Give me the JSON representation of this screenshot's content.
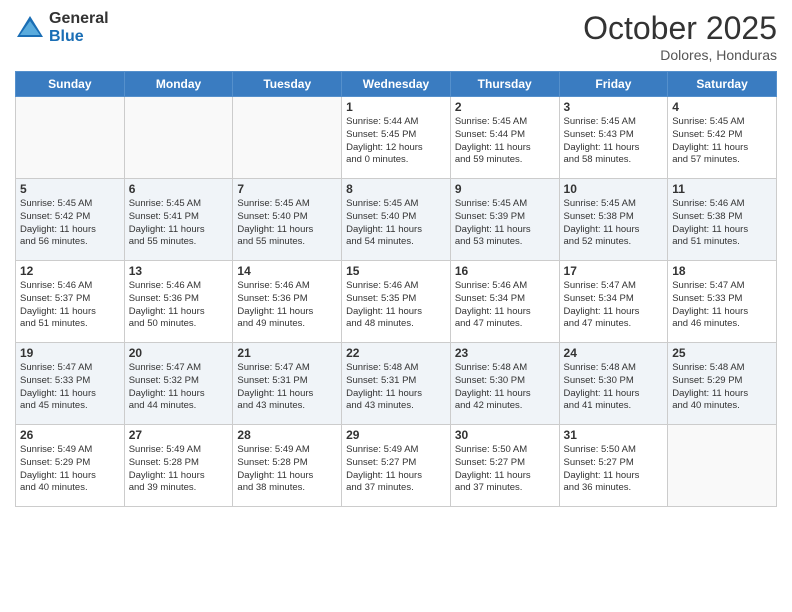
{
  "header": {
    "logo_general": "General",
    "logo_blue": "Blue",
    "month": "October 2025",
    "location": "Dolores, Honduras"
  },
  "days_of_week": [
    "Sunday",
    "Monday",
    "Tuesday",
    "Wednesday",
    "Thursday",
    "Friday",
    "Saturday"
  ],
  "weeks": [
    [
      {
        "day": "",
        "info": ""
      },
      {
        "day": "",
        "info": ""
      },
      {
        "day": "",
        "info": ""
      },
      {
        "day": "1",
        "info": "Sunrise: 5:44 AM\nSunset: 5:45 PM\nDaylight: 12 hours\nand 0 minutes."
      },
      {
        "day": "2",
        "info": "Sunrise: 5:45 AM\nSunset: 5:44 PM\nDaylight: 11 hours\nand 59 minutes."
      },
      {
        "day": "3",
        "info": "Sunrise: 5:45 AM\nSunset: 5:43 PM\nDaylight: 11 hours\nand 58 minutes."
      },
      {
        "day": "4",
        "info": "Sunrise: 5:45 AM\nSunset: 5:42 PM\nDaylight: 11 hours\nand 57 minutes."
      }
    ],
    [
      {
        "day": "5",
        "info": "Sunrise: 5:45 AM\nSunset: 5:42 PM\nDaylight: 11 hours\nand 56 minutes."
      },
      {
        "day": "6",
        "info": "Sunrise: 5:45 AM\nSunset: 5:41 PM\nDaylight: 11 hours\nand 55 minutes."
      },
      {
        "day": "7",
        "info": "Sunrise: 5:45 AM\nSunset: 5:40 PM\nDaylight: 11 hours\nand 55 minutes."
      },
      {
        "day": "8",
        "info": "Sunrise: 5:45 AM\nSunset: 5:40 PM\nDaylight: 11 hours\nand 54 minutes."
      },
      {
        "day": "9",
        "info": "Sunrise: 5:45 AM\nSunset: 5:39 PM\nDaylight: 11 hours\nand 53 minutes."
      },
      {
        "day": "10",
        "info": "Sunrise: 5:45 AM\nSunset: 5:38 PM\nDaylight: 11 hours\nand 52 minutes."
      },
      {
        "day": "11",
        "info": "Sunrise: 5:46 AM\nSunset: 5:38 PM\nDaylight: 11 hours\nand 51 minutes."
      }
    ],
    [
      {
        "day": "12",
        "info": "Sunrise: 5:46 AM\nSunset: 5:37 PM\nDaylight: 11 hours\nand 51 minutes."
      },
      {
        "day": "13",
        "info": "Sunrise: 5:46 AM\nSunset: 5:36 PM\nDaylight: 11 hours\nand 50 minutes."
      },
      {
        "day": "14",
        "info": "Sunrise: 5:46 AM\nSunset: 5:36 PM\nDaylight: 11 hours\nand 49 minutes."
      },
      {
        "day": "15",
        "info": "Sunrise: 5:46 AM\nSunset: 5:35 PM\nDaylight: 11 hours\nand 48 minutes."
      },
      {
        "day": "16",
        "info": "Sunrise: 5:46 AM\nSunset: 5:34 PM\nDaylight: 11 hours\nand 47 minutes."
      },
      {
        "day": "17",
        "info": "Sunrise: 5:47 AM\nSunset: 5:34 PM\nDaylight: 11 hours\nand 47 minutes."
      },
      {
        "day": "18",
        "info": "Sunrise: 5:47 AM\nSunset: 5:33 PM\nDaylight: 11 hours\nand 46 minutes."
      }
    ],
    [
      {
        "day": "19",
        "info": "Sunrise: 5:47 AM\nSunset: 5:33 PM\nDaylight: 11 hours\nand 45 minutes."
      },
      {
        "day": "20",
        "info": "Sunrise: 5:47 AM\nSunset: 5:32 PM\nDaylight: 11 hours\nand 44 minutes."
      },
      {
        "day": "21",
        "info": "Sunrise: 5:47 AM\nSunset: 5:31 PM\nDaylight: 11 hours\nand 43 minutes."
      },
      {
        "day": "22",
        "info": "Sunrise: 5:48 AM\nSunset: 5:31 PM\nDaylight: 11 hours\nand 43 minutes."
      },
      {
        "day": "23",
        "info": "Sunrise: 5:48 AM\nSunset: 5:30 PM\nDaylight: 11 hours\nand 42 minutes."
      },
      {
        "day": "24",
        "info": "Sunrise: 5:48 AM\nSunset: 5:30 PM\nDaylight: 11 hours\nand 41 minutes."
      },
      {
        "day": "25",
        "info": "Sunrise: 5:48 AM\nSunset: 5:29 PM\nDaylight: 11 hours\nand 40 minutes."
      }
    ],
    [
      {
        "day": "26",
        "info": "Sunrise: 5:49 AM\nSunset: 5:29 PM\nDaylight: 11 hours\nand 40 minutes."
      },
      {
        "day": "27",
        "info": "Sunrise: 5:49 AM\nSunset: 5:28 PM\nDaylight: 11 hours\nand 39 minutes."
      },
      {
        "day": "28",
        "info": "Sunrise: 5:49 AM\nSunset: 5:28 PM\nDaylight: 11 hours\nand 38 minutes."
      },
      {
        "day": "29",
        "info": "Sunrise: 5:49 AM\nSunset: 5:27 PM\nDaylight: 11 hours\nand 37 minutes."
      },
      {
        "day": "30",
        "info": "Sunrise: 5:50 AM\nSunset: 5:27 PM\nDaylight: 11 hours\nand 37 minutes."
      },
      {
        "day": "31",
        "info": "Sunrise: 5:50 AM\nSunset: 5:27 PM\nDaylight: 11 hours\nand 36 minutes."
      },
      {
        "day": "",
        "info": ""
      }
    ]
  ]
}
